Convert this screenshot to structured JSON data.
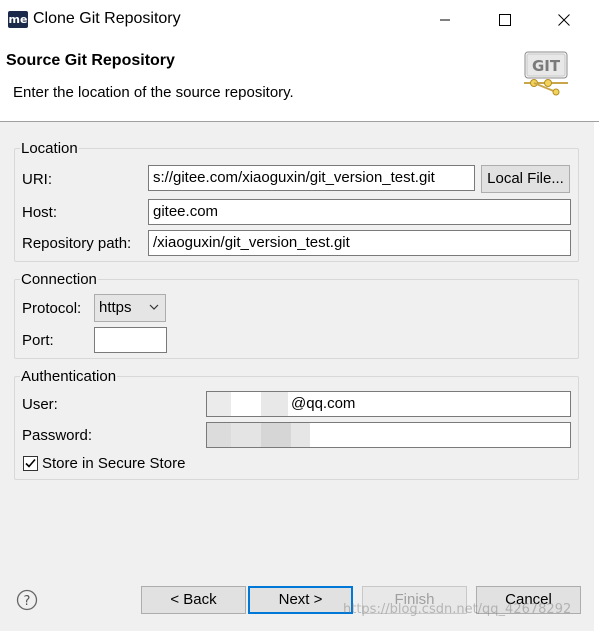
{
  "window": {
    "title": "Clone Git Repository",
    "app_icon_text": "me"
  },
  "header": {
    "title": "Source Git Repository",
    "description": "Enter the location of the source repository.",
    "logo_text": "GIT"
  },
  "location": {
    "group_label": "Location",
    "uri_label": "URI:",
    "uri_value": "s://gitee.com/xiaoguxin/git_version_test.git",
    "local_file_button": "Local File...",
    "host_label": "Host:",
    "host_value": "gitee.com",
    "repo_path_label": "Repository path:",
    "repo_path_value": "/xiaoguxin/git_version_test.git"
  },
  "connection": {
    "group_label": "Connection",
    "protocol_label": "Protocol:",
    "protocol_value": "https",
    "port_label": "Port:",
    "port_value": ""
  },
  "authentication": {
    "group_label": "Authentication",
    "user_label": "User:",
    "user_value_visible": "@qq.com",
    "password_label": "Password:",
    "store_label": "Store in Secure Store",
    "store_checked": true
  },
  "buttons": {
    "back": "< Back",
    "next": "Next >",
    "finish": "Finish",
    "cancel": "Cancel"
  },
  "watermark": "https://blog.csdn.net/qq_42678292",
  "icons": {
    "help": "help-icon",
    "minimize": "minimize-icon",
    "maximize": "maximize-icon",
    "close": "close-icon",
    "checkmark": "checkmark-icon"
  },
  "colors": {
    "default_button_border": "#0078d7",
    "background": "#f0f0f0"
  }
}
